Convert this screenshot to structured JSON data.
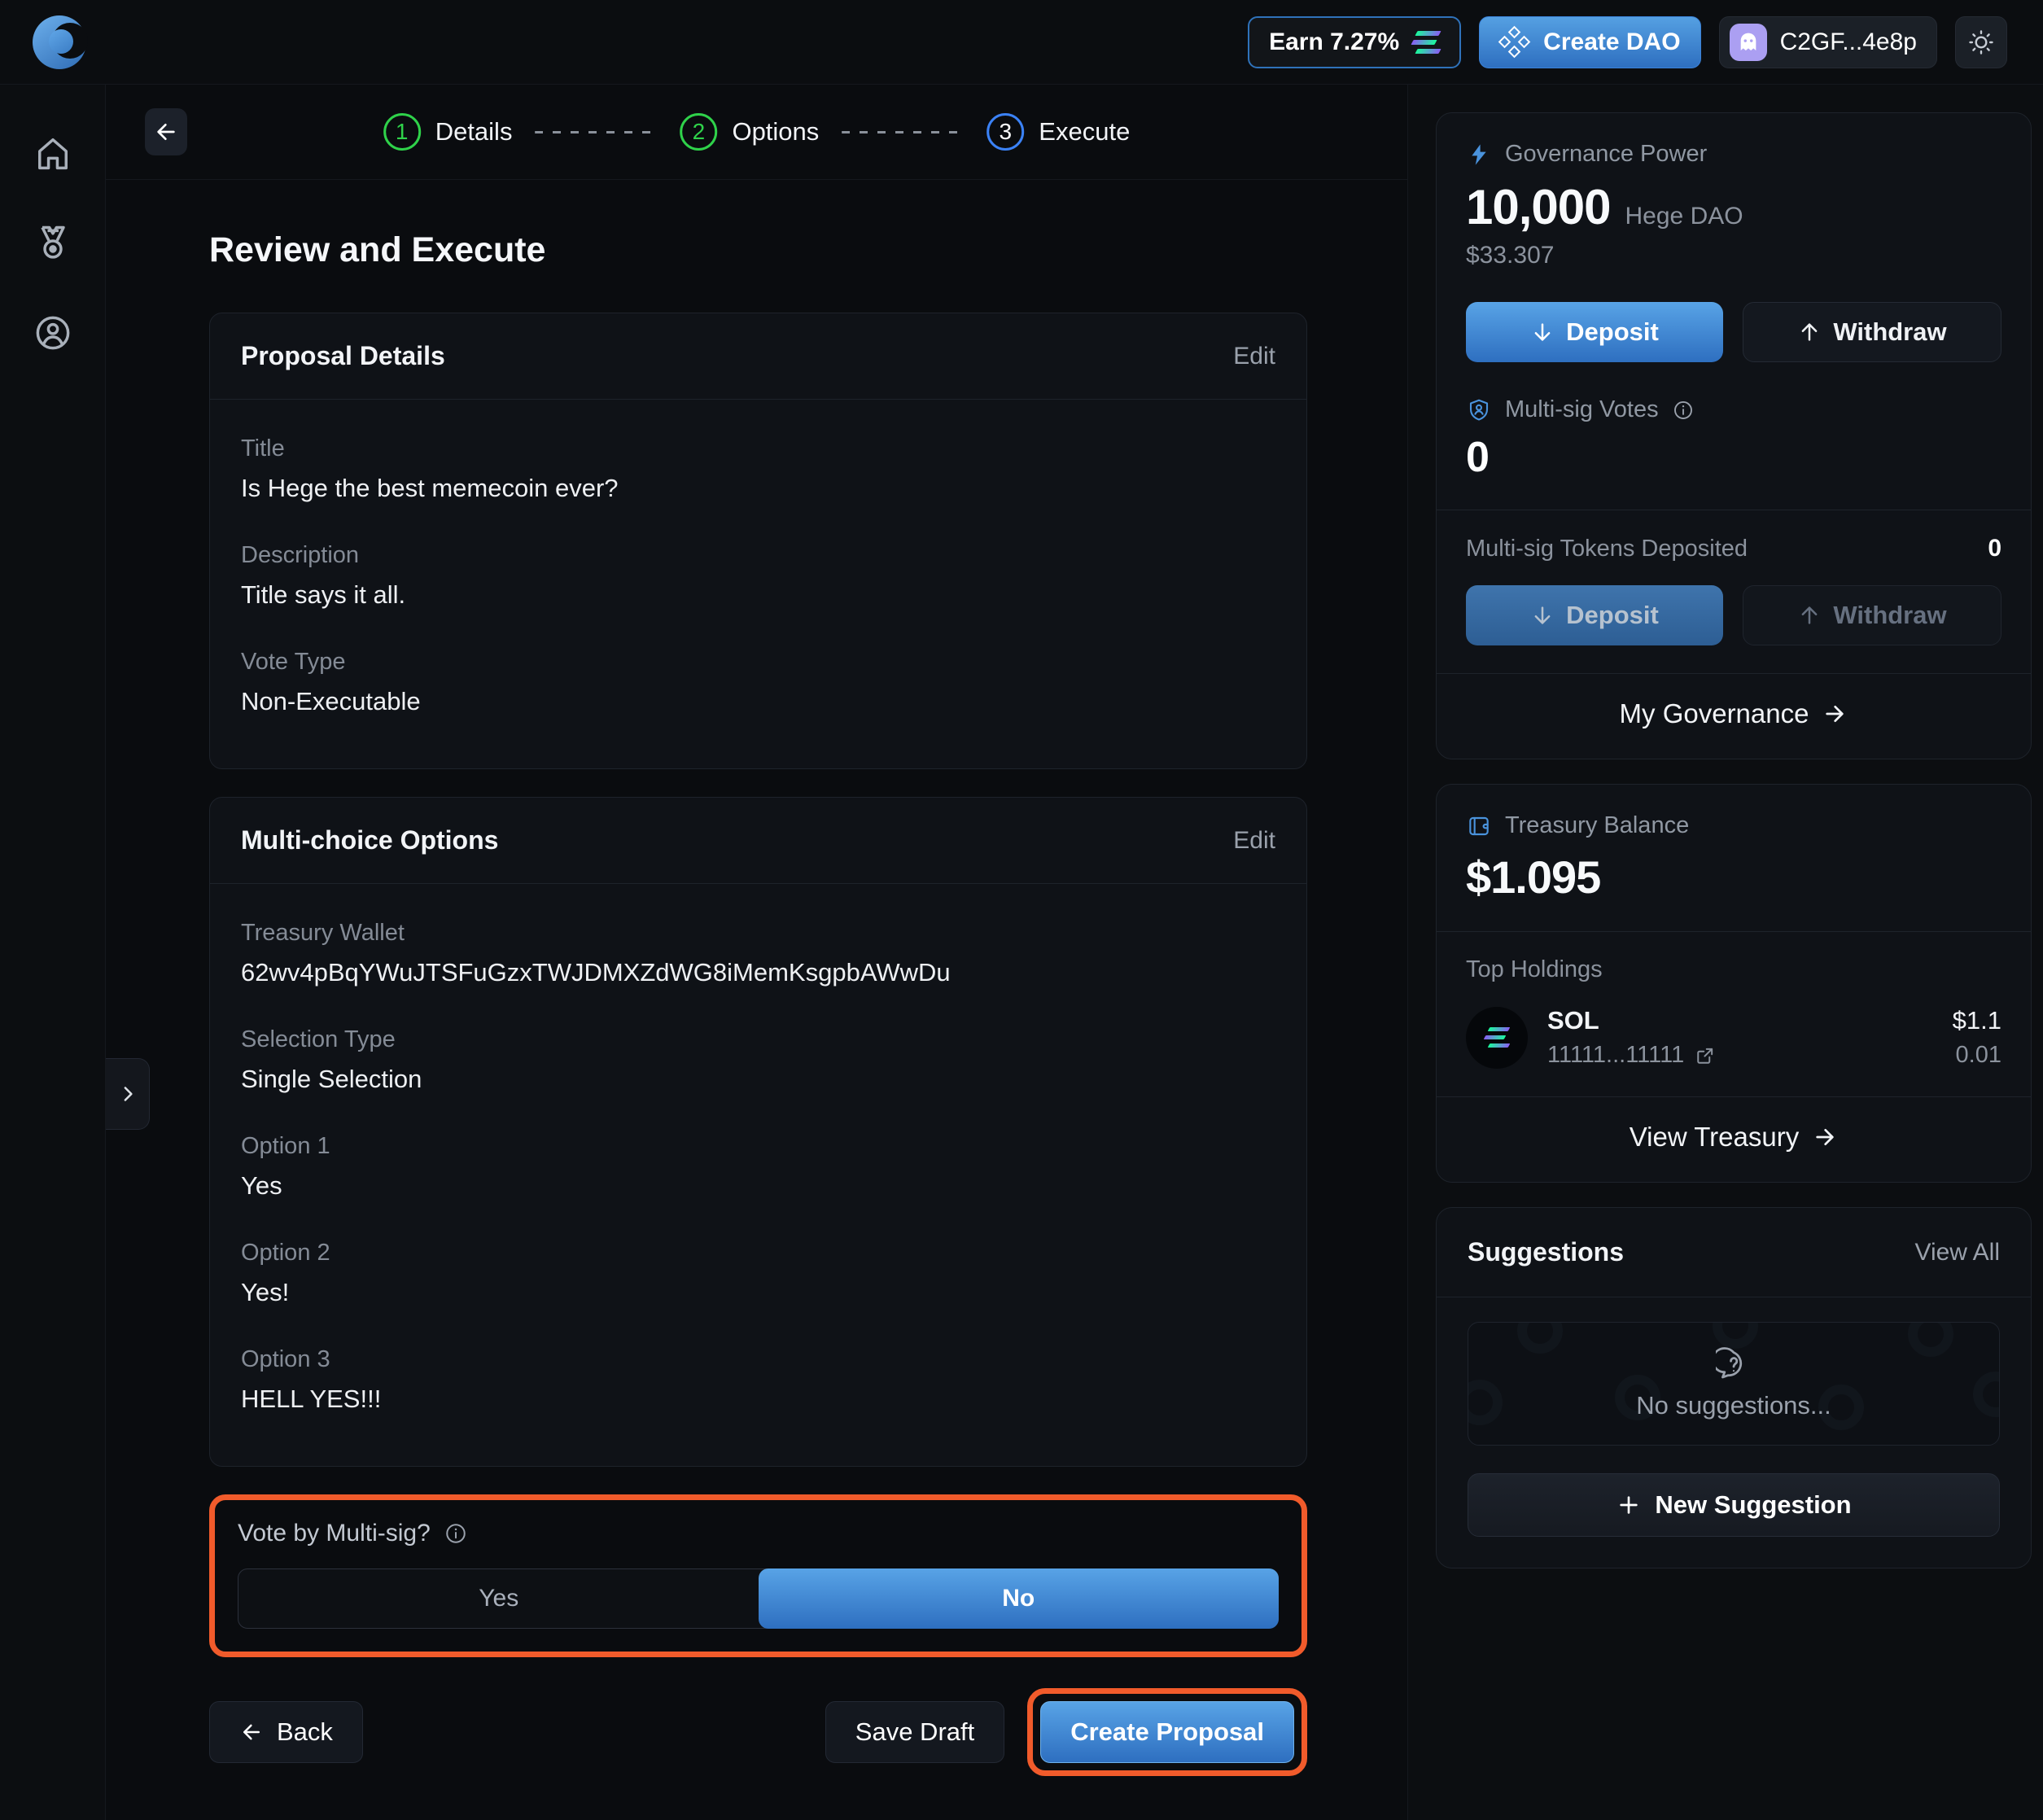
{
  "header": {
    "earn": "Earn 7.27%",
    "create_dao": "Create DAO",
    "wallet": "C2GF...4e8p"
  },
  "stepper": {
    "step1_num": "1",
    "step1_label": "Details",
    "step2_num": "2",
    "step2_label": "Options",
    "step3_num": "3",
    "step3_label": "Execute"
  },
  "main": {
    "title": "Review and Execute",
    "proposal": {
      "header": "Proposal Details",
      "edit": "Edit",
      "title_label": "Title",
      "title_value": "Is Hege the best memecoin ever?",
      "description_label": "Description",
      "description_value": "Title says it all.",
      "vote_type_label": "Vote Type",
      "vote_type_value": "Non-Executable"
    },
    "options": {
      "header": "Multi-choice Options",
      "edit": "Edit",
      "treasury_wallet_label": "Treasury Wallet",
      "treasury_wallet_value": "62wv4pBqYWuJTSFuGzxTWJDMXZdWG8iMemKsgpbAWwDu",
      "selection_type_label": "Selection Type",
      "selection_type_value": "Single Selection",
      "option1_label": "Option 1",
      "option1_value": "Yes",
      "option2_label": "Option 2",
      "option2_value": "Yes!",
      "option3_label": "Option 3",
      "option3_value": "HELL YES!!!"
    },
    "multisig": {
      "label": "Vote by Multi-sig?",
      "yes": "Yes",
      "no": "No",
      "selected": "No"
    },
    "actions": {
      "back": "Back",
      "save_draft": "Save Draft",
      "create_proposal": "Create Proposal"
    }
  },
  "governance": {
    "title": "Governance Power",
    "amount": "10,000",
    "dao_name": "Hege DAO",
    "usd_value": "$33.307",
    "deposit": "Deposit",
    "withdraw": "Withdraw",
    "multisig_votes_label": "Multi-sig Votes",
    "multisig_votes_value": "0",
    "multisig_tokens_label": "Multi-sig Tokens Deposited",
    "multisig_tokens_value": "0",
    "deposit2": "Deposit",
    "withdraw2": "Withdraw",
    "my_governance": "My Governance"
  },
  "treasury": {
    "title": "Treasury Balance",
    "balance": "$1.095",
    "top_holdings_label": "Top Holdings",
    "token_symbol": "SOL",
    "token_address": "11111...11111",
    "token_usd": "$1.1",
    "token_amount": "0.01",
    "view_treasury": "View Treasury"
  },
  "suggestions": {
    "title": "Suggestions",
    "view_all": "View All",
    "empty_text": "No suggestions...",
    "new_suggestion": "New Suggestion"
  },
  "colors": {
    "accent_blue": "#3b82f6",
    "step_green": "#2fd24a",
    "highlight_orange": "#f15b2b",
    "solana_teal": "#19fb9b",
    "solana_purple": "#8a5cf5",
    "phantom_purple": "#ab9ff2"
  }
}
